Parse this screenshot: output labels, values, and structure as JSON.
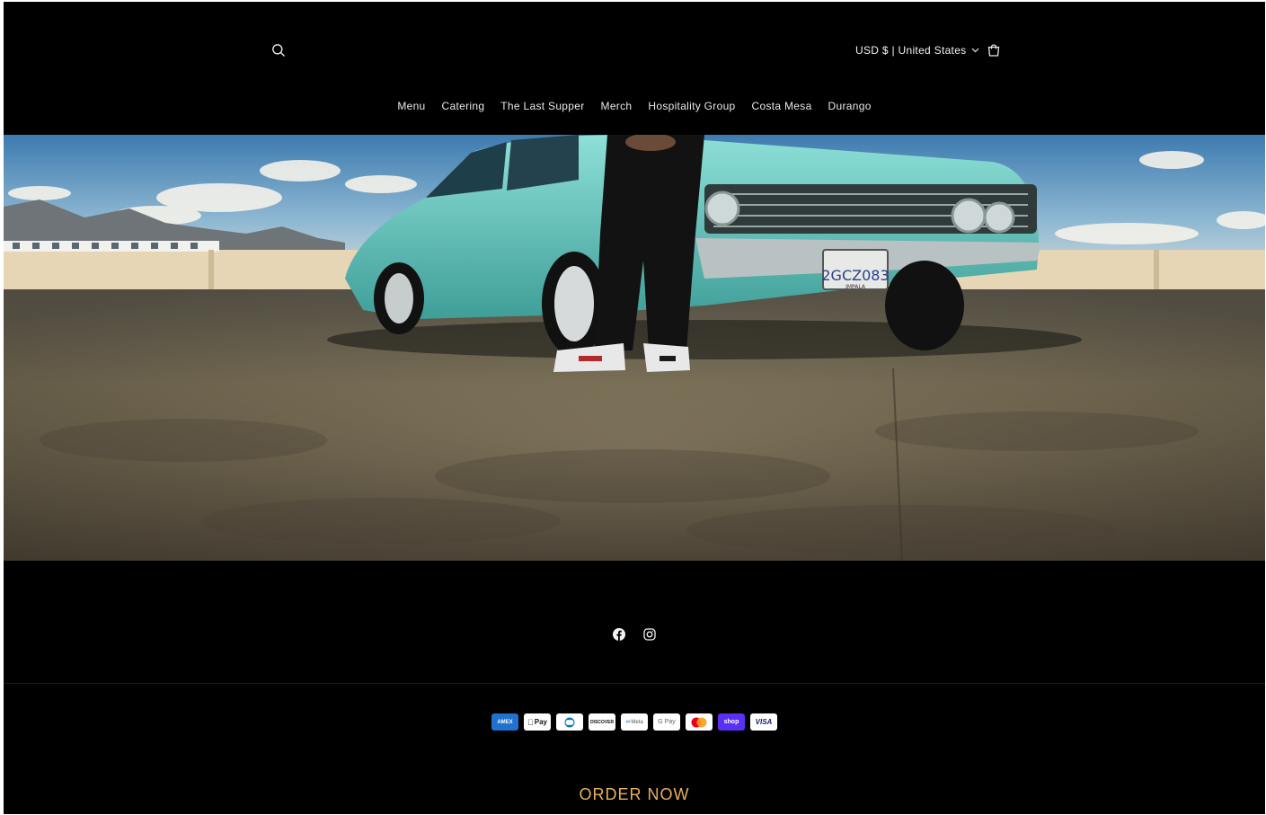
{
  "header": {
    "currency_label": "USD $ | United States",
    "nav": [
      {
        "label": "Menu"
      },
      {
        "label": "Catering"
      },
      {
        "label": "The Last Supper"
      },
      {
        "label": "Merch"
      },
      {
        "label": "Hospitality Group"
      },
      {
        "label": "Costa Mesa"
      },
      {
        "label": "Durango"
      }
    ]
  },
  "hero": {
    "plate_text": "2GCZ083",
    "plate_bottom": "IMPALA"
  },
  "payments": [
    {
      "name": "american-express",
      "label": "AMEX",
      "bg": "#1f72cd",
      "fg": "#ffffff"
    },
    {
      "name": "apple-pay",
      "label": "Pay",
      "bg": "#ffffff",
      "fg": "#000000"
    },
    {
      "name": "diners-club",
      "label": "",
      "bg": "#ffffff",
      "fg": "#0079be"
    },
    {
      "name": "discover",
      "label": "DISCOVER",
      "bg": "#ffffff",
      "fg": "#000000"
    },
    {
      "name": "meta-pay",
      "label": "Meta",
      "bg": "#ffffff",
      "fg": "#555555"
    },
    {
      "name": "google-pay",
      "label": "G Pay",
      "bg": "#ffffff",
      "fg": "#5f6368"
    },
    {
      "name": "mastercard",
      "label": "",
      "bg": "#ffffff",
      "fg": "#eb001b"
    },
    {
      "name": "shop-pay",
      "label": "shop",
      "bg": "#5a31f4",
      "fg": "#ffffff"
    },
    {
      "name": "visa",
      "label": "VISA",
      "bg": "#ffffff",
      "fg": "#1a1f71"
    }
  ],
  "footer": {
    "order_label": "ORDER NOW"
  },
  "colors": {
    "background": "#000000",
    "accent": "#e8b15a"
  }
}
